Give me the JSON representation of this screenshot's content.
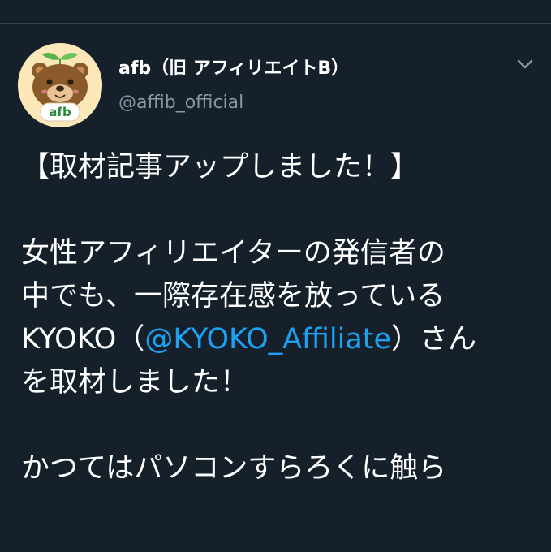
{
  "tweet": {
    "author_name": "afb（旧 アフィリエイトB）",
    "author_handle": "@affib_official",
    "avatar_text": "afb",
    "lines": {
      "l1": "【取材記事アップしました！】",
      "l2": "女性アフィリエイターの発信者の",
      "l3": "中でも、一際存在感を放っている",
      "l4_before": "KYOKO（",
      "l4_mention": "@KYOKO_Affiliate",
      "l4_after": "）さん",
      "l5": "を取材しました！",
      "l6": "かつてはパソコンすらろくに触ら"
    }
  },
  "colors": {
    "background": "#15202b",
    "text": "#ffffff",
    "secondary": "#8899a6",
    "link": "#1da1f2",
    "divider": "#38444d"
  },
  "icons": {
    "menu": "chevron-down-icon",
    "avatar": "bear-mascot"
  }
}
